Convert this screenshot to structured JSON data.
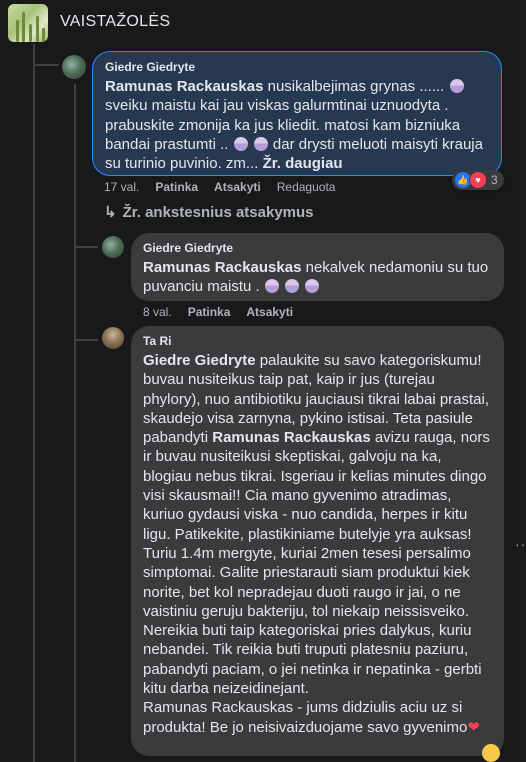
{
  "group": {
    "name": "VAISTAŽOLĖS"
  },
  "comments": [
    {
      "author": "Giedre Giedryte",
      "mention": "Ramunas Rackauskas",
      "text": " nusikalbejimas grynas ...... ",
      "text2": " sveiku maistu kai jau viskas galurmtinai uznuodyta . prabuskite zmonija ka jus kliedit. matosi kam bizniuka bandai prastumti .. ",
      "text3": " dar drysti meluoti maisyti krauja su turinio puvinio. zm... ",
      "see_more": "Žr. daugiau",
      "time": "17 val.",
      "like": "Patinka",
      "reply": "Atsakyti",
      "edited": "Redaguota",
      "reaction_count": "3"
    },
    {
      "author": "Giedre Giedryte",
      "mention": "Ramunas Rackauskas",
      "text": " nekalvek nedamoniu su tuo puvanciu maistu . ",
      "time": "8 val.",
      "like": "Patinka",
      "reply": "Atsakyti"
    },
    {
      "author": "Ta Ri",
      "mention": "Giedre Giedryte",
      "text1": " palaukite su savo kategoriskumu! buvau nusiteikus taip pat, kaip ir jus (turejau phylory), nuo antibiotiku jauciausi tikrai labai prastai, skaudejo visa zarnyna, pykino istisai. Teta pasiule pabandyti ",
      "mention2": "Ramunas Rackauskas",
      "text2": " avizu rauga, nors ir buvau nusiteikusi skeptiskai, galvoju na ka, blogiau nebus tikrai. Isgeriau ir kelias minutes dingo visi skausmai!! Cia mano gyvenimo atradimas, kuriuo gydausi viska - nuo candida, herpes ir kitu ligu. Patikekite, plastikiniame butelyje yra auksas!",
      "text3": "Turiu 1.4m mergyte, kuriai 2men tesesi persalimo simptomai. Galite priestarauti siam produktui kiek norite, bet kol nepradejau duoti raugo ir jai, o ne vaistiniu geruju bakteriju, tol niekaip neissisveiko. Nereikia buti taip kategoriskai pries dalykus, kuriu nebandei. Tik reikia buti truputi platesniu paziuru, pabandyti paciam, o jei netinka ir nepatinka - gerbti kitu darba neizeidinejant.",
      "text4": "Ramunas Rackauskas - jums didziulis aciu uz si produkta! Be jo neisivaizduojame savo gyvenimo"
    }
  ],
  "view_previous": "Žr. ankstesnius atsakymus",
  "icons": [
    "moss-avatar",
    "rocks-avatar",
    "like-icon",
    "love-icon",
    "reply-arrow-icon",
    "praying-emoji",
    "heart-emoji"
  ]
}
